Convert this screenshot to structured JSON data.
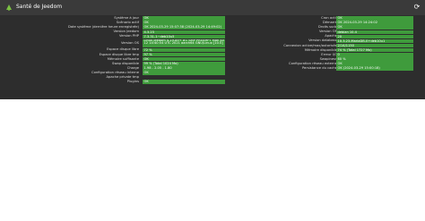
{
  "header": {
    "title": "Santé de Jeedom",
    "logo_icon": "jeedom-leaf-icon",
    "refresh_icon": "refresh-icon",
    "colors": {
      "header_bg": "#3a3a3a",
      "panel_bg": "#2d2d2d",
      "ok_green": "#3f9b3c"
    }
  },
  "left": [
    {
      "label": "Système à jour",
      "value": "OK"
    },
    {
      "label": "Scénario actif",
      "value": "OK"
    },
    {
      "label": "Date système (dernière heure enregistrée)",
      "value": "OK 2024-03-29 15:07:38 (2024-03-29 14:49:02)"
    },
    {
      "label": "Version Jeedom",
      "value": "4.3.23"
    },
    {
      "label": "Version PHP",
      "value": "7.3.31-1~deb10u5"
    },
    {
      "label": "Version OS",
      "value": "Linux Jeedom 4.19.89+ #1 SMP PREEMPT Mon Jul 12 14:40:54 UTC 2021 aarch64 GNU/Linux [10.0]"
    },
    {
      "label": "Espace disque libre",
      "value": "72 %"
    },
    {
      "label": "Espace disque libre tmp",
      "value": "97 %"
    },
    {
      "label": "Mémoire suffisante",
      "value": "OK"
    },
    {
      "label": "Swap disponible",
      "value": "99 % (Total 1024 Mo)"
    },
    {
      "label": "Charge",
      "value": "1.98 - 2.05 - 1.80"
    },
    {
      "label": "Configuration réseau interne",
      "value": "OK"
    },
    {
      "label": "Apache private tmp",
      "value": ""
    },
    {
      "label": "Plugins",
      "value": "OK"
    }
  ],
  "right": [
    {
      "label": "Cron actif",
      "value": "OK"
    },
    {
      "label": "Démarré",
      "value": "OK 2024-03-29 14:24:02"
    },
    {
      "label": "Droits sudo",
      "value": "OK"
    },
    {
      "label": "Version OS",
      "value": "debian 10.4"
    },
    {
      "label": "Apache",
      "value": "20"
    },
    {
      "label": "Version database",
      "value": "10.3.23-MariaDB-0+deb10u1"
    },
    {
      "label": "Connexion active/max/autorisée",
      "value": "2/14/1150"
    },
    {
      "label": "Mémoire disponible",
      "value": "74 % (Total 1727 Mo)"
    },
    {
      "label": "Erreur I/O",
      "value": "0"
    },
    {
      "label": "Swapiness",
      "value": "60 %"
    },
    {
      "label": "Configuration réseau externe",
      "value": "OK"
    },
    {
      "label": "Persistance du cache",
      "value": "OK (2024-03-29 15:00:18)"
    }
  ]
}
